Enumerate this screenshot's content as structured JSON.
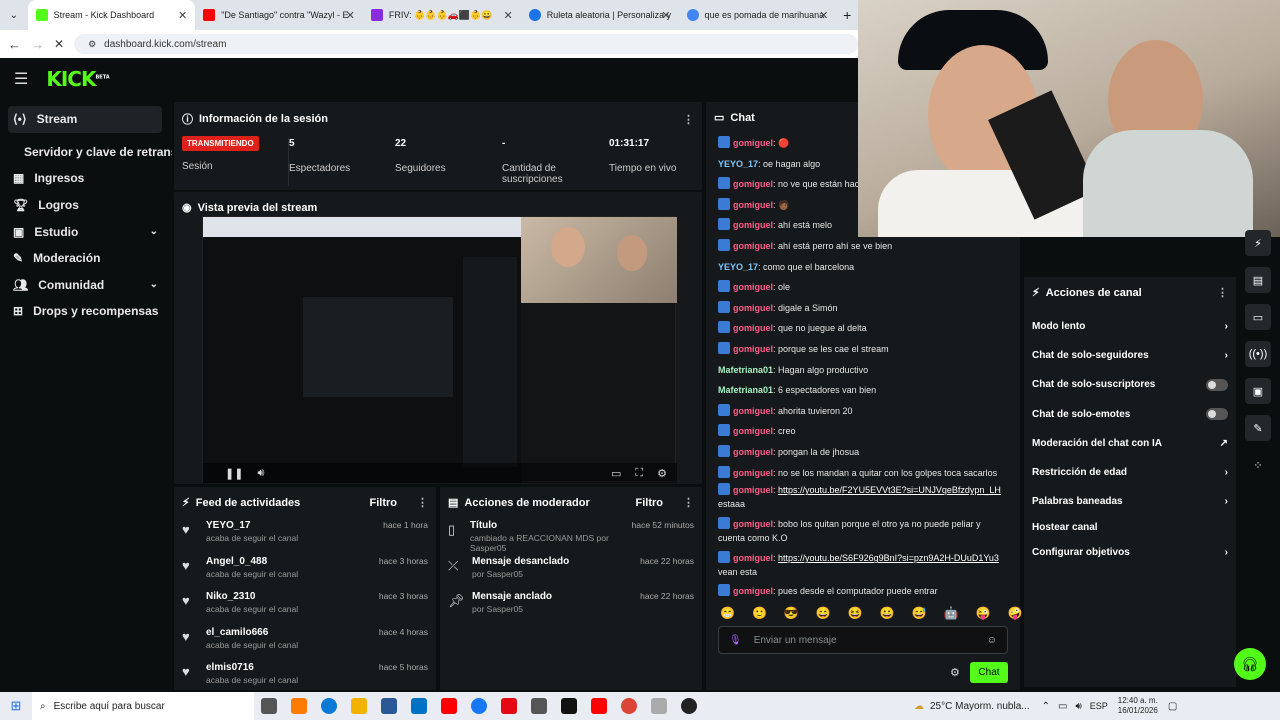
{
  "browser": {
    "tabs": [
      {
        "label": "Stream - Kick Dashboard",
        "fav": "#53fc18"
      },
      {
        "label": "\"De Santiago\" contra \"Wazyl - E",
        "fav": "#ff0000"
      },
      {
        "label": "FRIV: 👶👶👶🚗⬛👶😀",
        "fav": "#8a2be2"
      },
      {
        "label": "Ruleta aleatoria | Personaliza y",
        "fav": "#1a73e8"
      },
      {
        "label": "que es pomada de marihuana",
        "fav": "#4285f4"
      }
    ],
    "url": "dashboard.kick.com/stream"
  },
  "brand": {
    "logo": "KICK",
    "beta": "BETA"
  },
  "sidebar": {
    "items": [
      {
        "label": "Stream",
        "icon": "stream-icon"
      },
      {
        "label": "Servidor y clave de retransmisión",
        "icon": ""
      },
      {
        "label": "Ingresos",
        "icon": "revenue-icon"
      },
      {
        "label": "Logros",
        "icon": "trophy-icon"
      },
      {
        "label": "Estudio",
        "icon": "studio-icon"
      },
      {
        "label": "Moderación",
        "icon": "wrench-icon"
      },
      {
        "label": "Comunidad",
        "icon": "community-icon"
      },
      {
        "label": "Drops y recompensas",
        "icon": "drops-icon"
      }
    ]
  },
  "session": {
    "title": "Información de la sesión",
    "status": "TRANSMITIENDO",
    "status_label": "Sesión",
    "stats": [
      {
        "value": "5",
        "label": "Espectadores"
      },
      {
        "value": "22",
        "label": "Seguidores"
      },
      {
        "value": "-",
        "label": "Cantidad de suscripciones"
      },
      {
        "value": "01:31:17",
        "label": "Tiempo en vivo"
      }
    ]
  },
  "preview": {
    "title": "Vista previa del stream"
  },
  "feed": {
    "title": "Feed de actividades",
    "filter": "Filtro",
    "items": [
      {
        "user": "YEYO_17",
        "desc": "acaba de seguir el canal",
        "time": "hace 1 hora"
      },
      {
        "user": "Angel_0_488",
        "desc": "acaba de seguir el canal",
        "time": "hace 3 horas"
      },
      {
        "user": "Niko_2310",
        "desc": "acaba de seguir el canal",
        "time": "hace 3 horas"
      },
      {
        "user": "el_camilo666",
        "desc": "acaba de seguir el canal",
        "time": "hace 4 horas"
      },
      {
        "user": "elmis0716",
        "desc": "acaba de seguir el canal",
        "time": "hace 5 horas"
      }
    ]
  },
  "modactions": {
    "title": "Acciones de moderador",
    "filter": "Filtro",
    "items": [
      {
        "title": "Título",
        "desc": "cambiado a REACCIONAN MDS por Sasper05",
        "time": "hace 52 minutos",
        "icon": "title-icon"
      },
      {
        "title": "Mensaje desanclado",
        "desc": "por Sasper05",
        "time": "hace 22 horas",
        "icon": "unpin-icon"
      },
      {
        "title": "Mensaje anclado",
        "desc": "por Sasper05",
        "time": "hace 22 horas",
        "icon": "pin-icon"
      }
    ]
  },
  "chat": {
    "title": "Chat",
    "messages": [
      {
        "user": "gomiguel",
        "color": "#ff5c8a",
        "text": "🔴",
        "badge": true
      },
      {
        "user": "YEYO_17",
        "color": "#7ec8ff",
        "text": "oe hagan algo",
        "badge": false
      },
      {
        "user": "gomiguel",
        "color": "#ff5c8a",
        "text": "no ve que están haciendo",
        "badge": true
      },
      {
        "user": "gomiguel",
        "color": "#ff5c8a",
        "text": "🧑🏾",
        "badge": true
      },
      {
        "user": "gomiguel",
        "color": "#ff5c8a",
        "text": "ahí está melo",
        "badge": true
      },
      {
        "user": "gomiguel",
        "color": "#ff5c8a",
        "text": "ahí está perro ahí se ve bien",
        "badge": true
      },
      {
        "user": "YEYO_17",
        "color": "#7ec8ff",
        "text": "como que el barcelona",
        "badge": false
      },
      {
        "user": "gomiguel",
        "color": "#ff5c8a",
        "text": "ole",
        "badge": true
      },
      {
        "user": "gomiguel",
        "color": "#ff5c8a",
        "text": "digale a Simón",
        "badge": true
      },
      {
        "user": "gomiguel",
        "color": "#ff5c8a",
        "text": "que no juegue al delta",
        "badge": true
      },
      {
        "user": "gomiguel",
        "color": "#ff5c8a",
        "text": "porque se les cae el stream",
        "badge": true
      },
      {
        "user": "Mafetriana01",
        "color": "#a8f0c0",
        "text": "Hagan algo productivo",
        "badge": false
      },
      {
        "user": "Mafetriana01",
        "color": "#a8f0c0",
        "text": "6 espectadores van bien",
        "badge": false
      },
      {
        "user": "gomiguel",
        "color": "#ff5c8a",
        "text": "ahorita tuvieron 20",
        "badge": true
      },
      {
        "user": "gomiguel",
        "color": "#ff5c8a",
        "text": "creo",
        "badge": true
      },
      {
        "user": "gomiguel",
        "color": "#ff5c8a",
        "text": "pongan la de jhosua",
        "badge": true
      },
      {
        "user": "gomiguel",
        "color": "#ff5c8a",
        "text": "no se los mandan a quitar con los golpes toca sacarlos",
        "badge": true
      }
    ],
    "link1": "https://youtu.be/F2YU5EVVt3E?si=UNJVqeBfzdypn_LH",
    "link1_tail": "estaaa",
    "msg_bobo": "bobo los quitan porque el otro ya no puede peliar y",
    "msg_bobo_tail": "cuenta como K.O",
    "link2": "https://youtu.be/S6F926g9BnI?si=pzn9A2H-DUuD1Yu3",
    "link2_tail": "vean esta",
    "last_user": "gomiguel",
    "last_text": "pues desde el computador puede entrar",
    "placeholder": "Enviar un mensaje",
    "send": "Chat"
  },
  "actions": {
    "title": "Acciones de canal",
    "items": [
      {
        "label": "Modo lento",
        "control": "chevron"
      },
      {
        "label": "Chat de solo-seguidores",
        "control": "chevron"
      },
      {
        "label": "Chat de solo-suscriptores",
        "control": "toggle"
      },
      {
        "label": "Chat de solo-emotes",
        "control": "toggle"
      },
      {
        "label": "Moderación del chat con IA",
        "control": "external"
      },
      {
        "label": "Restricción de edad",
        "control": "chevron"
      },
      {
        "label": "Palabras baneadas",
        "control": "chevron"
      },
      {
        "label": "Hostear canal",
        "control": "none"
      },
      {
        "label": "Configurar objetivos",
        "control": "chevron"
      }
    ]
  },
  "taskbar": {
    "search": "Escribe aquí para buscar",
    "weather": "25°C  Mayorm. nubla...",
    "lang": "ESP",
    "time": "12:40 a. m.",
    "date": "16/01/2026"
  },
  "colors": {
    "accent": "#53fc18",
    "live": "#e0211b"
  }
}
